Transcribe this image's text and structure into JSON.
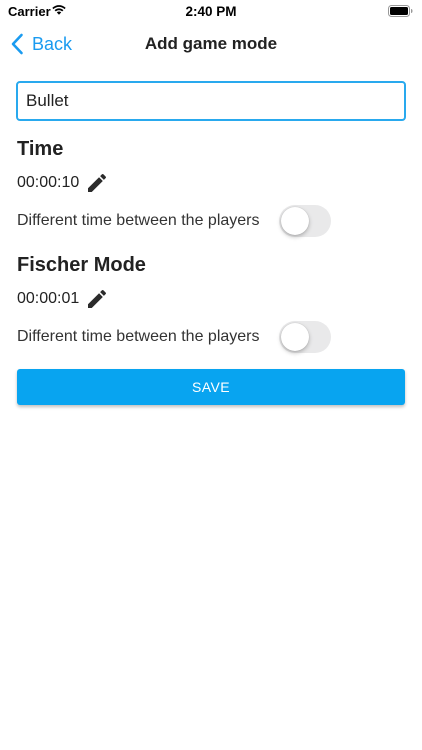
{
  "status_bar": {
    "carrier": "Carrier",
    "time": "2:40 PM",
    "wifi_icon": "wifi-icon",
    "battery_icon": "battery-icon"
  },
  "nav": {
    "back_label": "Back",
    "title": "Add game mode",
    "back_icon": "chevron-left-icon",
    "accent_color": "#1a9bf0"
  },
  "form": {
    "name_value": "Bullet",
    "time": {
      "title": "Time",
      "value": "00:00:10",
      "toggle_label": "Different time between the players",
      "toggle_on": false
    },
    "fischer": {
      "title": "Fischer Mode",
      "value": "00:00:01",
      "toggle_label": "Different time between the players",
      "toggle_on": false
    },
    "save_label": "SAVE",
    "save_color": "#08a4f0",
    "input_border_color": "#29a9ee"
  }
}
